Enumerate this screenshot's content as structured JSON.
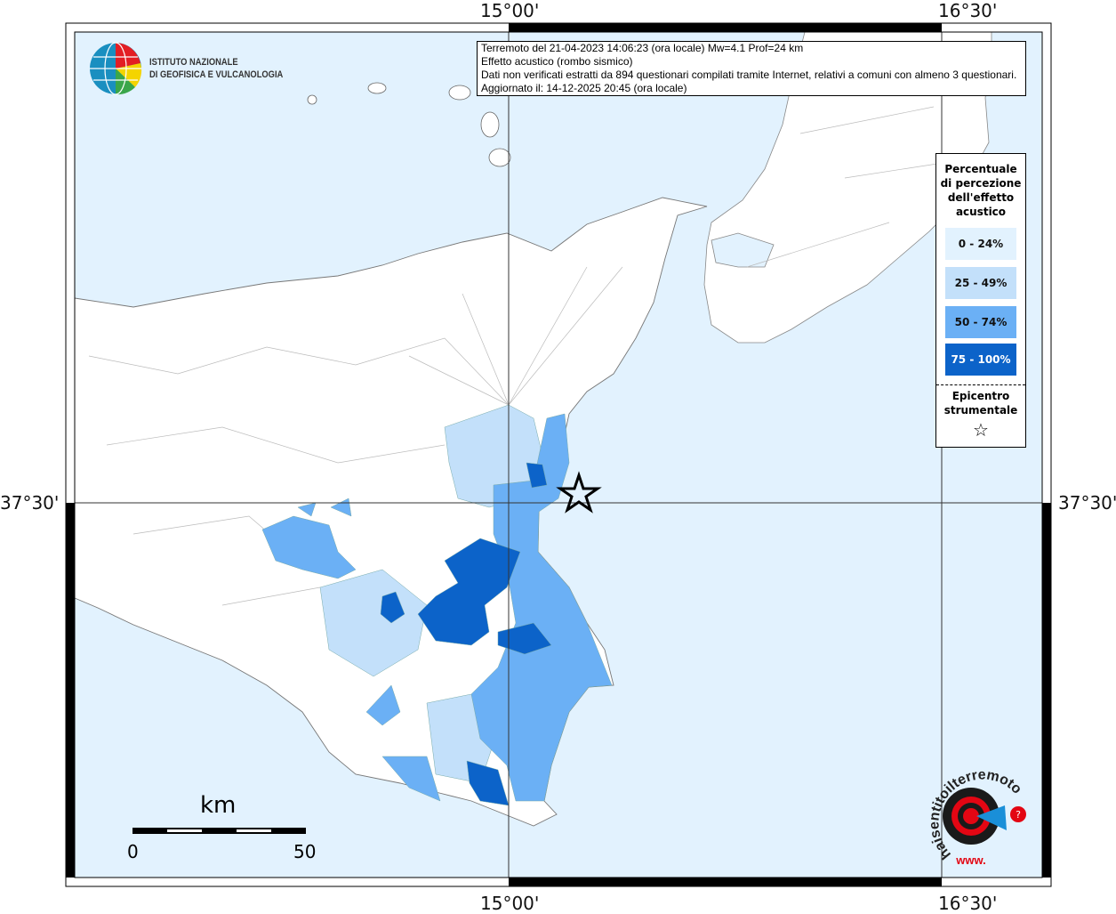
{
  "ticks": {
    "top_left": "15°00'",
    "top_right": "16°30'",
    "bottom_left": "15°00'",
    "bottom_right": "16°30'",
    "left": "37°30'",
    "right": "37°30'"
  },
  "logo_ingv": {
    "line1": "ISTITUTO NAZIONALE",
    "line2": "DI GEOFISICA E VULCANOLOGIA"
  },
  "info": {
    "line1": "Terremoto del 21-04-2023 14:06:23 (ora locale) Mw=4.1 Prof=24 km",
    "line2": "Effetto acustico (rombo sismico)",
    "line3": "Dati non verificati estratti da 894 questionari compilati tramite Internet, relativi a comuni con almeno 3 questionari.",
    "line4": "Aggiornato il: 14-12-2025 20:45 (ora locale)"
  },
  "legend": {
    "title_lines": [
      "Percentuale",
      "di percezione",
      "dell'effetto",
      "acustico"
    ],
    "classes": [
      {
        "label": "0 - 24%",
        "color": "#e2f2fe"
      },
      {
        "label": "25 - 49%",
        "color": "#c3e0fa"
      },
      {
        "label": "50 - 74%",
        "color": "#6bb0f5"
      },
      {
        "label": "75 - 100%",
        "color": "#0c63c9"
      }
    ],
    "epicenter_lines": [
      "Epicentro",
      "strumentale"
    ],
    "epicenter_symbol": "☆"
  },
  "scale": {
    "unit": "km",
    "min": "0",
    "max": "50"
  },
  "logo_hsit": {
    "text": "haisentitoilterremoto.it",
    "prefix": "www."
  },
  "colors": {
    "sea": "#e2f2fe",
    "land": "#ffffff"
  }
}
